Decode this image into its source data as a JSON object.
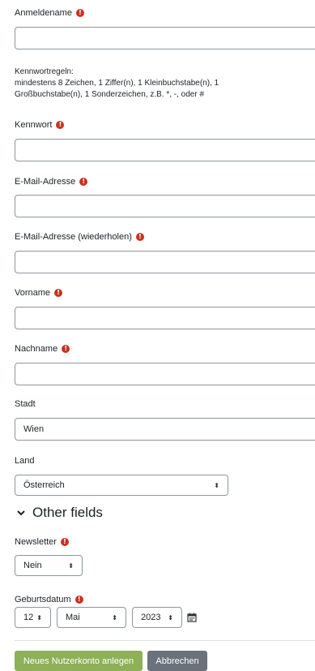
{
  "fields": {
    "username": {
      "label": "Anmeldename",
      "value": ""
    },
    "password_rules": {
      "title": "Kennwortregeln:",
      "line1": "mindestens 8 Zeichen, 1 Ziffer(n), 1 Kleinbuchstabe(n), 1",
      "line2": "Großbuchstabe(n), 1 Sonderzeichen, z.B. *, -, oder #"
    },
    "password": {
      "label": "Kennwort",
      "value": ""
    },
    "email": {
      "label": "E-Mail-Adresse",
      "value": ""
    },
    "email_repeat": {
      "label": "E-Mail-Adresse (wiederholen)",
      "value": ""
    },
    "firstname": {
      "label": "Vorname",
      "value": ""
    },
    "lastname": {
      "label": "Nachname",
      "value": ""
    },
    "city": {
      "label": "Stadt",
      "value": "Wien"
    },
    "country": {
      "label": "Land",
      "value": "Österreich"
    }
  },
  "required_icon": "!",
  "other_fields": {
    "title": "Other fields",
    "chevron": "⌄"
  },
  "newsletter": {
    "label": "Newsletter",
    "value": "Nein"
  },
  "birthdate": {
    "label": "Geburtsdatum",
    "day": "12",
    "month": "Mai",
    "year": "2023"
  },
  "select_arrow": "⬍",
  "buttons": {
    "submit": "Neues Nutzerkonto anlegen",
    "cancel": "Abbrechen"
  },
  "colors": {
    "required": "#ca3120",
    "submit": "#8db058",
    "cancel": "#6a737b"
  }
}
